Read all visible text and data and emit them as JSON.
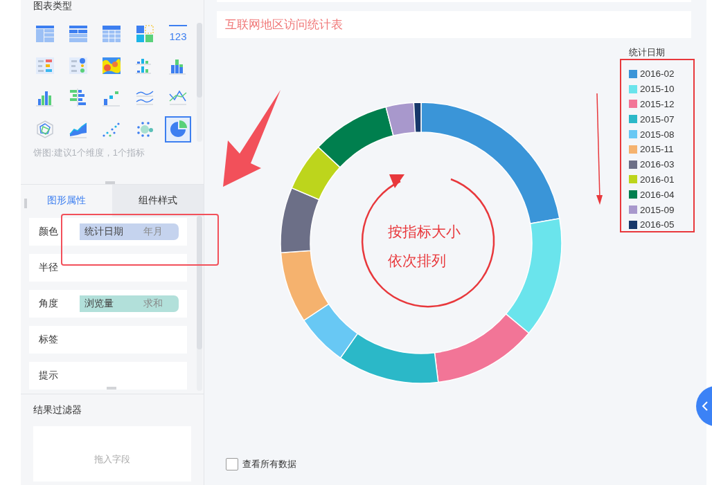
{
  "sidebar": {
    "chart_type_heading": "图表类型",
    "chart_types": [
      {
        "kind": "table",
        "selected": false
      },
      {
        "kind": "crosstable",
        "selected": false
      },
      {
        "kind": "grid",
        "selected": false
      },
      {
        "kind": "blocks",
        "selected": false
      },
      {
        "kind": "number",
        "text": "123",
        "selected": false
      },
      {
        "kind": "kpi-list",
        "selected": false
      },
      {
        "kind": "kpi-dots",
        "selected": false
      },
      {
        "kind": "heatmap",
        "selected": false
      },
      {
        "kind": "grouped-bars",
        "selected": false
      },
      {
        "kind": "stacked-bars",
        "selected": false
      },
      {
        "kind": "bars",
        "selected": false
      },
      {
        "kind": "hbars",
        "selected": false
      },
      {
        "kind": "steps",
        "selected": false
      },
      {
        "kind": "lines",
        "selected": false
      },
      {
        "kind": "combo",
        "selected": false
      },
      {
        "kind": "radar",
        "selected": false
      },
      {
        "kind": "area",
        "selected": false
      },
      {
        "kind": "scatter",
        "selected": false
      },
      {
        "kind": "bubble",
        "selected": false
      },
      {
        "kind": "pie",
        "selected": true
      }
    ],
    "hint": "饼图:建议1个维度，1个指标",
    "tabs": [
      {
        "label": "图形属性",
        "selected": true
      },
      {
        "label": "组件样式",
        "selected": false
      }
    ],
    "properties": [
      {
        "label": "颜色",
        "field": {
          "name": "统计日期",
          "aggregation": "年月",
          "kind": "dimension"
        }
      },
      {
        "label": "半径"
      },
      {
        "label": "角度",
        "field": {
          "name": "浏览量",
          "aggregation": "求和",
          "kind": "measure"
        }
      },
      {
        "label": "标签"
      },
      {
        "label": "提示"
      }
    ],
    "filter": {
      "heading": "结果过滤器",
      "placeholder": "拖入字段"
    }
  },
  "chart": {
    "title": "互联网地区访问统计表",
    "legend": {
      "title": "统计日期",
      "items": [
        {
          "label": "2016-02",
          "color": "#3a95d8"
        },
        {
          "label": "2015-10",
          "color": "#6ae4ec"
        },
        {
          "label": "2015-12",
          "color": "#f27597"
        },
        {
          "label": "2015-07",
          "color": "#2bb8c8"
        },
        {
          "label": "2015-08",
          "color": "#68c8f4"
        },
        {
          "label": "2015-11",
          "color": "#f5b26e"
        },
        {
          "label": "2016-03",
          "color": "#6c6f87"
        },
        {
          "label": "2016-01",
          "color": "#bdd51c"
        },
        {
          "label": "2016-04",
          "color": "#007f4e"
        },
        {
          "label": "2015-09",
          "color": "#a898cc"
        },
        {
          "label": "2016-05",
          "color": "#17386b"
        }
      ]
    },
    "show_all_data": {
      "label": "查看所有数据",
      "checked": false
    }
  },
  "annotation": {
    "note": [
      "按指标大小",
      "依次排列"
    ]
  }
}
